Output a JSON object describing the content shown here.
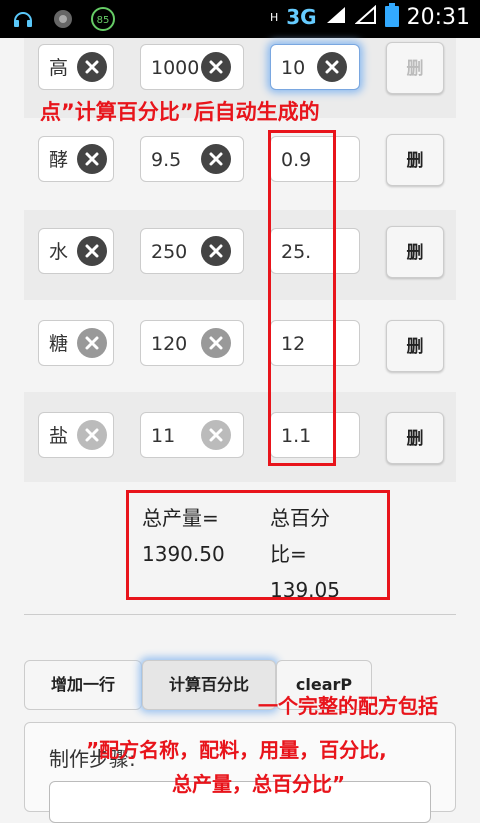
{
  "status_bar": {
    "time": "20:31",
    "network": "3G",
    "sim1": "T1",
    "sim2": "T2",
    "battery_level_badge": "85"
  },
  "rows": [
    {
      "name": "高",
      "amount": "1000",
      "percent": "10",
      "delete_label": "删"
    },
    {
      "name": "酵",
      "amount": "9.5",
      "percent": "0.9",
      "delete_label": "删"
    },
    {
      "name": "水",
      "amount": "250",
      "percent": "25.",
      "delete_label": "删"
    },
    {
      "name": "糖",
      "amount": "120",
      "percent": "12",
      "delete_label": "删"
    },
    {
      "name": "盐",
      "amount": "11",
      "percent": "1.1",
      "delete_label": "删"
    }
  ],
  "annotation_top": "点”计算百分比”后自动生成的",
  "totals": {
    "total_amount_label": "总产量=",
    "total_amount_value": "1390.50",
    "total_percent_label_1": "总百分",
    "total_percent_label_2": "比=",
    "total_percent_value": "139.05"
  },
  "buttons": {
    "add_row": "增加一行",
    "calc_percent": "计算百分比",
    "clear": "clearP"
  },
  "steps": {
    "label": "制作步骤:"
  },
  "annotation_bottom": {
    "line1": "一个完整的配方包括",
    "line2": "”配方名称，配料，用量，百分比,",
    "line3": "总产量，总百分比”"
  },
  "colors": {
    "annotation_red": "#e8141b",
    "focus_glow": "#8fbcf0"
  }
}
